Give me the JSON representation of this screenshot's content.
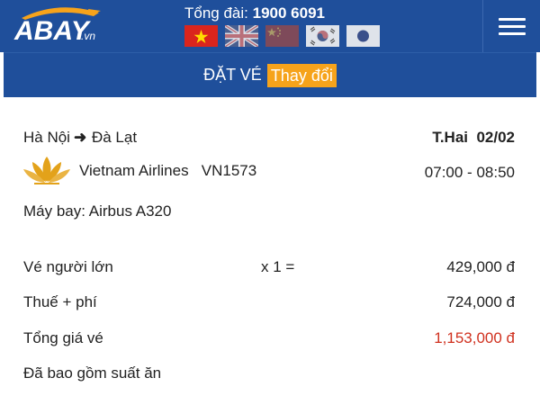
{
  "header": {
    "logo_text": "ABAY",
    "logo_suffix": ".vn",
    "hotline_label": "Tổng đài:",
    "hotline_number": "1900 6091",
    "languages": [
      "vietnamese-flag",
      "english-flag",
      "chinese-flag",
      "korean-flag",
      "japanese-flag"
    ]
  },
  "bar": {
    "title": "ĐẶT VÉ",
    "change_label": "Thay đổi"
  },
  "flight": {
    "from": "Hà Nội",
    "to": "Đà Lạt",
    "day": "T.Hai",
    "date": "02/02",
    "airline": "Vietnam Airlines",
    "flight_no": "VN1573",
    "time": "07:00 - 08:50",
    "aircraft": "Máy bay: Airbus A320"
  },
  "prices": {
    "adult_label": "Vé người lớn",
    "adult_qty": "x 1 =",
    "adult_price": "429,000 đ",
    "tax_label": "Thuế + phí",
    "tax_price": "724,000 đ",
    "total_label": "Tổng giá vé",
    "total_price": "1,153,000 đ",
    "meal_note": "Đã bao gồm suất ăn"
  },
  "colors": {
    "header_bg": "#1f4f9b",
    "accent": "#f6a31b",
    "total": "#d0311f"
  }
}
